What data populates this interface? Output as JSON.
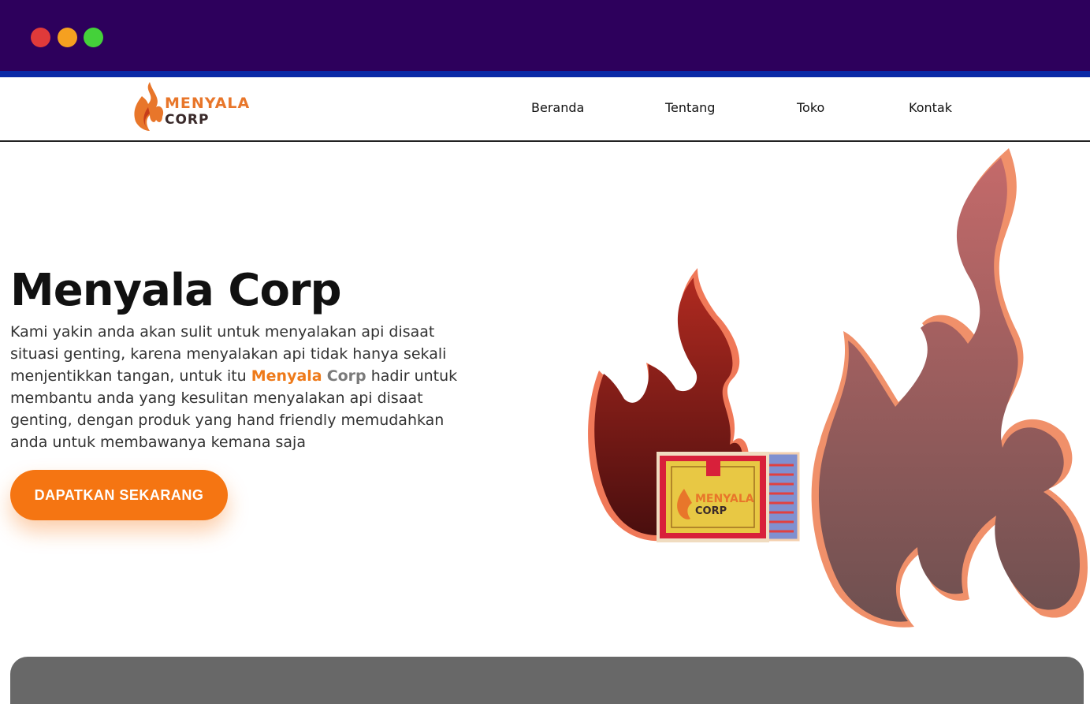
{
  "window": {
    "controls": [
      "close",
      "minimize",
      "maximize"
    ]
  },
  "brand": {
    "logo_top": "MENYALA",
    "logo_bottom": "CORP"
  },
  "nav": {
    "items": [
      {
        "label": "Beranda"
      },
      {
        "label": "Tentang"
      },
      {
        "label": "Toko"
      },
      {
        "label": "Kontak"
      }
    ]
  },
  "hero": {
    "title": "Menyala Corp",
    "text_before": "Kami yakin anda akan sulit untuk menyalakan api disaat situasi genting, karena menyalakan api tidak hanya sekali menjentikkan tangan, untuk itu ",
    "brand_part1": "Menyala",
    "brand_part2": "Corp",
    "text_after": " hadir untuk membantu anda yang kesulitan menyalakan api disaat genting, dengan produk yang hand friendly memudahkan anda untuk membawanya kemana saja",
    "cta_label": "DAPATKAN SEKARANG"
  },
  "product_box": {
    "logo_top": "MENYALA",
    "logo_bottom": "CORP"
  },
  "colors": {
    "titlebar": "#2d005c",
    "accent_orange": "#f57512",
    "flame_dark": "#7a1a14",
    "flame_light": "#f0906a"
  },
  "icons": [
    "flame-logo-icon",
    "flame-illustration",
    "matchbox-illustration"
  ]
}
